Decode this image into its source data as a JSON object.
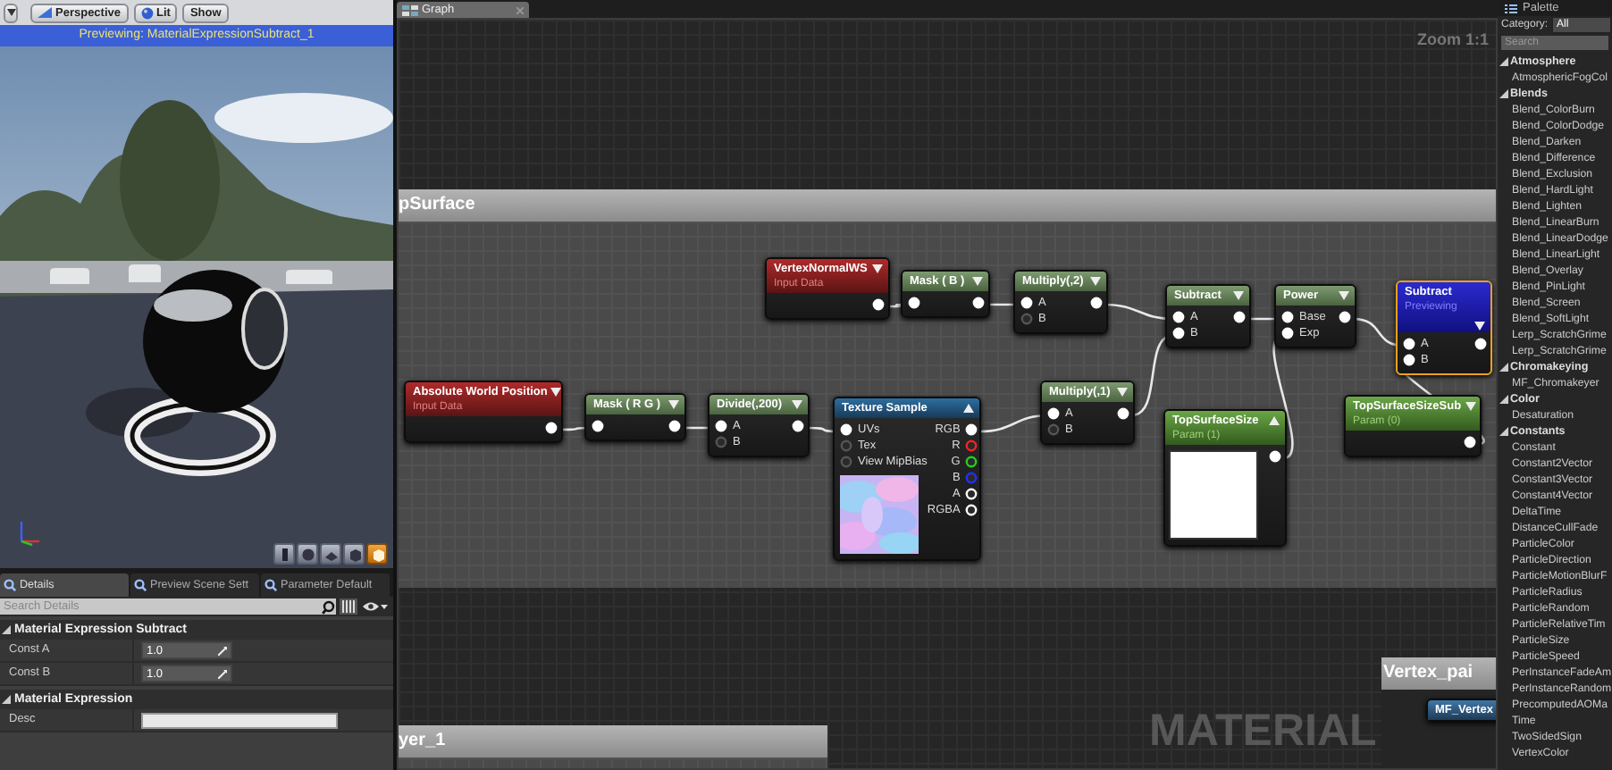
{
  "preview_viewport": {
    "toolbar": [
      {
        "label": "Perspective"
      },
      {
        "label": "Lit"
      },
      {
        "label": "Show"
      }
    ],
    "banner": "Previewing: MaterialExpressionSubtract_1",
    "view_buttons": [
      {
        "selected": false
      },
      {
        "selected": false
      },
      {
        "selected": false
      },
      {
        "selected": false
      },
      {
        "selected": true
      }
    ]
  },
  "details": {
    "tabs": [
      {
        "label": "Details",
        "selected": true
      },
      {
        "label": "Preview Scene Sett",
        "selected": false
      },
      {
        "label": "Parameter Default",
        "selected": false
      }
    ],
    "search": {
      "placeholder": "Search Details"
    },
    "categories": [
      {
        "title": "Material Expression Subtract",
        "expanded": true,
        "properties": [
          {
            "label": "Const A",
            "kind": "number",
            "value": "1.0"
          },
          {
            "label": "Const B",
            "kind": "number",
            "value": "1.0"
          }
        ]
      },
      {
        "title": "Material Expression",
        "expanded": true,
        "properties": [
          {
            "label": "Desc",
            "kind": "text"
          }
        ]
      }
    ]
  },
  "graph": {
    "tab": {
      "label": "Graph"
    },
    "zoom": "Zoom 1:1",
    "comments": [
      {
        "title": "pSurface"
      },
      {
        "title": "yer_1"
      },
      {
        "title": "Vertex_pai"
      }
    ],
    "nodes": [
      {
        "kind": "input",
        "title": "VertexNormalWS",
        "subtitle": "Input Data",
        "selected": false,
        "expanded": false,
        "outputs": [
          {
            "connected": true
          }
        ]
      },
      {
        "kind": "function",
        "title": "Mask ( B )",
        "selected": false,
        "expanded": false,
        "inputs": [
          {
            "connected": true
          }
        ],
        "outputs": [
          {
            "connected": true
          }
        ]
      },
      {
        "kind": "function",
        "title": "Multiply(,2)",
        "selected": false,
        "expanded": false,
        "inputs": [
          {
            "label": "A",
            "connected": true
          },
          {
            "label": "B",
            "connected": false
          }
        ],
        "outputs": [
          {
            "connected": true
          }
        ]
      },
      {
        "kind": "function",
        "title": "Subtract",
        "selected": false,
        "expanded": false,
        "inputs": [
          {
            "label": "A",
            "connected": true
          },
          {
            "label": "B",
            "connected": true
          }
        ],
        "outputs": [
          {
            "connected": true
          }
        ]
      },
      {
        "kind": "function",
        "title": "Power",
        "selected": false,
        "expanded": false,
        "inputs": [
          {
            "label": "Base",
            "connected": true
          },
          {
            "label": "Exp",
            "connected": true
          }
        ],
        "outputs": [
          {
            "connected": true
          }
        ]
      },
      {
        "kind": "preview",
        "title": "Subtract",
        "subtitle": "Previewing",
        "selected": true,
        "expanded": false,
        "inputs": [
          {
            "label": "A",
            "connected": true
          },
          {
            "label": "B",
            "connected": true
          }
        ],
        "outputs": [
          {
            "connected": true
          }
        ]
      },
      {
        "kind": "param",
        "title": "TopSurfaceSizeSub",
        "subtitle": "Param (0)",
        "selected": false,
        "expanded": false,
        "outputs": [
          {
            "connected": true
          }
        ]
      },
      {
        "kind": "input",
        "title": "Absolute World Position",
        "subtitle": "Input Data",
        "selected": false,
        "expanded": false,
        "outputs": [
          {
            "connected": true
          }
        ]
      },
      {
        "kind": "function",
        "title": "Mask ( R G )",
        "selected": false,
        "expanded": false,
        "inputs": [
          {
            "connected": true
          }
        ],
        "outputs": [
          {
            "connected": true
          }
        ]
      },
      {
        "kind": "function",
        "title": "Divide(,200)",
        "selected": false,
        "expanded": false,
        "inputs": [
          {
            "label": "A",
            "connected": true
          },
          {
            "label": "B",
            "connected": false
          }
        ],
        "outputs": [
          {
            "connected": true
          }
        ]
      },
      {
        "kind": "texture",
        "title": "Texture Sample",
        "selected": false,
        "expanded": true,
        "inputs": [
          {
            "label": "UVs",
            "connected": true
          },
          {
            "label": "Tex",
            "connected": false
          },
          {
            "label": "View MipBias",
            "connected": false
          }
        ],
        "outputs": [
          {
            "label": "RGB",
            "connected": true,
            "color": "#ffffff"
          },
          {
            "label": "R",
            "connected": false,
            "color": "#ff2020"
          },
          {
            "label": "G",
            "connected": false,
            "color": "#20d020"
          },
          {
            "label": "B",
            "connected": false,
            "color": "#2030ff"
          },
          {
            "label": "A",
            "connected": false,
            "color": "#ffffff"
          },
          {
            "label": "RGBA",
            "connected": false,
            "color": "#ffffff"
          }
        ]
      },
      {
        "kind": "function",
        "title": "Multiply(,1)",
        "selected": false,
        "expanded": false,
        "inputs": [
          {
            "label": "A",
            "connected": true
          },
          {
            "label": "B",
            "connected": false
          }
        ],
        "outputs": [
          {
            "connected": true
          }
        ]
      },
      {
        "kind": "param",
        "title": "TopSurfaceSize",
        "subtitle": "Param (1)",
        "selected": false,
        "expanded": true,
        "outputs": [
          {
            "connected": true
          }
        ]
      },
      {
        "kind": "call",
        "title": "MF_Vertex",
        "selected": false
      }
    ],
    "watermark": "MATERIAL"
  },
  "palette": {
    "title": "Palette",
    "category": {
      "label": "Category:",
      "value": "All"
    },
    "search": {
      "placeholder": "Search"
    },
    "groups": [
      {
        "label": "Atmosphere",
        "expanded": true,
        "children": [
          {
            "label": "AtmosphericFogCol"
          }
        ]
      },
      {
        "label": "Blends",
        "expanded": true,
        "children": [
          {
            "label": "Blend_ColorBurn"
          },
          {
            "label": "Blend_ColorDodge"
          },
          {
            "label": "Blend_Darken"
          },
          {
            "label": "Blend_Difference"
          },
          {
            "label": "Blend_Exclusion"
          },
          {
            "label": "Blend_HardLight"
          },
          {
            "label": "Blend_Lighten"
          },
          {
            "label": "Blend_LinearBurn"
          },
          {
            "label": "Blend_LinearDodge"
          },
          {
            "label": "Blend_LinearLight"
          },
          {
            "label": "Blend_Overlay"
          },
          {
            "label": "Blend_PinLight"
          },
          {
            "label": "Blend_Screen"
          },
          {
            "label": "Blend_SoftLight"
          },
          {
            "label": "Lerp_ScratchGrime"
          },
          {
            "label": "Lerp_ScratchGrime"
          }
        ]
      },
      {
        "label": "Chromakeying",
        "expanded": true,
        "children": [
          {
            "label": "MF_Chromakeyer"
          }
        ]
      },
      {
        "label": "Color",
        "expanded": true,
        "children": [
          {
            "label": "Desaturation"
          }
        ]
      },
      {
        "label": "Constants",
        "expanded": true,
        "children": [
          {
            "label": "Constant"
          },
          {
            "label": "Constant2Vector"
          },
          {
            "label": "Constant3Vector"
          },
          {
            "label": "Constant4Vector"
          },
          {
            "label": "DeltaTime"
          },
          {
            "label": "DistanceCullFade"
          },
          {
            "label": "ParticleColor"
          },
          {
            "label": "ParticleDirection"
          },
          {
            "label": "ParticleMotionBlurF"
          },
          {
            "label": "ParticleRadius"
          },
          {
            "label": "ParticleRandom"
          },
          {
            "label": "ParticleRelativeTim"
          },
          {
            "label": "ParticleSize"
          },
          {
            "label": "ParticleSpeed"
          },
          {
            "label": "PerInstanceFadeAm"
          },
          {
            "label": "PerInstanceRandom"
          },
          {
            "label": "PrecomputedAOMa"
          },
          {
            "label": "Time"
          },
          {
            "label": "TwoSidedSign"
          },
          {
            "label": "VertexColor"
          }
        ]
      }
    ]
  }
}
